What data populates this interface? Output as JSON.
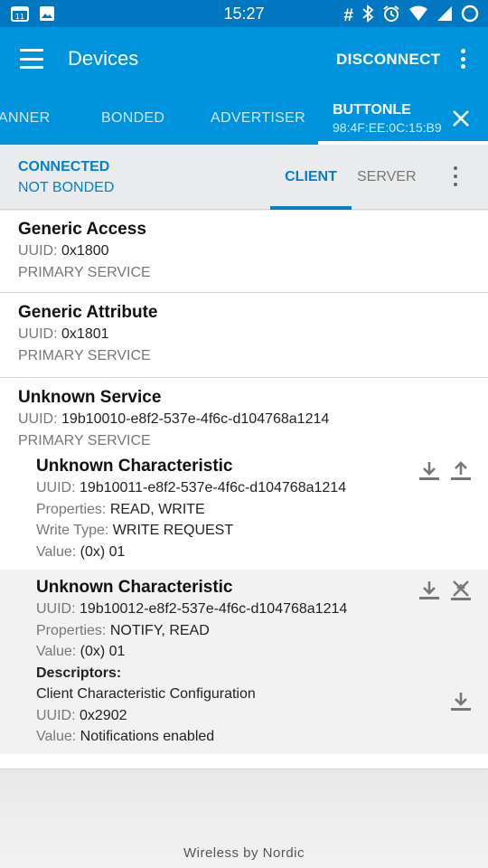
{
  "status_bar": {
    "time": "15:27",
    "left_icons": [
      "calendar-icon",
      "image-icon"
    ],
    "right_icons": [
      "hash-icon",
      "bluetooth-icon",
      "alarm-icon",
      "wifi-icon",
      "signal-icon",
      "battery-icon"
    ],
    "hash_glyph": "#",
    "bluetooth_glyph": "✱",
    "alarm_glyph": "⏰",
    "calendar_day": "11"
  },
  "app_bar": {
    "title": "Devices",
    "action": "DISCONNECT",
    "color": "#0093dd"
  },
  "tabs": {
    "partial_left": "ANNER",
    "bonded": "BONDED",
    "advertiser": "ADVERTISER",
    "active_name": "BUTTONLE",
    "active_address": "98:4F:EE:0C:15:B9"
  },
  "connection": {
    "state": "CONNECTED",
    "bond_state": "NOT BONDED",
    "client_tab": "CLIENT",
    "server_tab": "SERVER",
    "accent": "#0a7fc4"
  },
  "services": [
    {
      "name": "Generic Access",
      "uuid_label": "UUID:",
      "uuid": "0x1800",
      "type": "PRIMARY SERVICE"
    },
    {
      "name": "Generic Attribute",
      "uuid_label": "UUID:",
      "uuid": "0x1801",
      "type": "PRIMARY SERVICE"
    },
    {
      "name": "Unknown Service",
      "uuid_label": "UUID:",
      "uuid": "19b10010-e8f2-537e-4f6c-d104768a1214",
      "type": "PRIMARY SERVICE"
    }
  ],
  "characteristics": [
    {
      "name": "Unknown Characteristic",
      "uuid_label": "UUID:",
      "uuid": "19b10011-e8f2-537e-4f6c-d104768a1214",
      "properties_label": "Properties:",
      "properties": "READ, WRITE",
      "write_type_label": "Write Type:",
      "write_type": "WRITE REQUEST",
      "value_label": "Value:",
      "value": "(0x) 01"
    },
    {
      "name": "Unknown Characteristic",
      "uuid_label": "UUID:",
      "uuid": "19b10012-e8f2-537e-4f6c-d104768a1214",
      "properties_label": "Properties:",
      "properties": "NOTIFY, READ",
      "value_label": "Value:",
      "value": "(0x) 01",
      "descriptors_label": "Descriptors:",
      "descriptor": {
        "name": "Client Characteristic Configuration",
        "uuid_label": "UUID:",
        "uuid": "0x2902",
        "value_label": "Value:",
        "value": "Notifications enabled"
      }
    }
  ],
  "footer": {
    "text": "Wireless by Nordic"
  }
}
